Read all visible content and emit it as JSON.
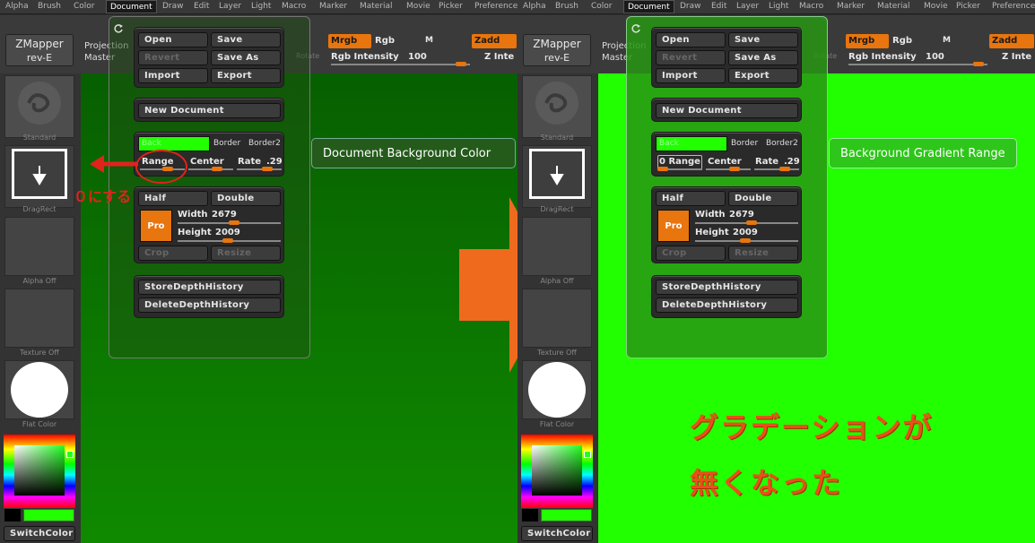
{
  "menu": {
    "items": [
      "Alpha",
      "Brush",
      "Color",
      "Document",
      "Draw",
      "Edit",
      "Layer",
      "Light",
      "Macro",
      "Marker",
      "Material",
      "Movie",
      "Picker",
      "Preference"
    ],
    "active": "Document"
  },
  "topbar": {
    "zmapper_title": "ZMapper",
    "zmapper_sub": "rev-E",
    "projection": "Projection",
    "master": "Master",
    "rotate": "Rotate",
    "mrgb": "Mrgb",
    "rgb": "Rgb",
    "m": "M",
    "zadd": "Zadd",
    "rgb_intensity_label": "Rgb Intensity",
    "rgb_intensity_value": "100",
    "z_intensity": "Z Inte"
  },
  "tray": {
    "standard": "Standard",
    "dragrect": "DragRect",
    "alpha_off": "Alpha  Off",
    "texture_off": "Texture  Off",
    "flat_color": "Flat Color",
    "switch_color": "SwitchColor"
  },
  "doc_panel": {
    "open": "Open",
    "save": "Save",
    "revert": "Revert",
    "save_as": "Save As",
    "import": "Import",
    "export": "Export",
    "new_document": "New Document",
    "back": "Back",
    "border": "Border",
    "border2": "Border2",
    "range": "Range",
    "range_zero": "0 Range",
    "center": "Center",
    "rate": "Rate",
    "rate_value": ".29",
    "half": "Half",
    "double": "Double",
    "pro": "Pro",
    "width_label": "Width",
    "width_value": "2679",
    "height_label": "Height",
    "height_value": "2009",
    "crop": "Crop",
    "resize": "Resize",
    "store_depth": "StoreDepthHistory",
    "delete_depth": "DeleteDepthHistory"
  },
  "tooltips": {
    "left": "Document Background Color",
    "right": "Background Gradient Range"
  },
  "annotations": {
    "set_zero": "０にする",
    "result_line1": "グラデーションが",
    "result_line2": "無くなった"
  },
  "colors": {
    "canvas_left_top": "#075f00",
    "canvas_left_bottom": "#0f8a00",
    "canvas_right": "#22ff00",
    "accent_orange": "#e8750e",
    "annotation_red": "#e0231c",
    "big_arrow": "#f06a1e"
  }
}
